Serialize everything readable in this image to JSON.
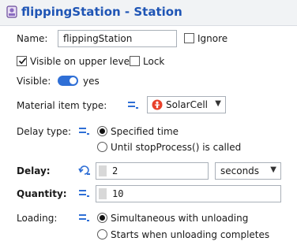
{
  "header": {
    "title": "flippingStation - Station",
    "logo_icon": "station-icon"
  },
  "name": {
    "label": "Name:",
    "value": "flippingStation",
    "ignore_label": "Ignore",
    "ignore_checked": false
  },
  "visible_upper": {
    "label": "Visible on upper level",
    "checked": true
  },
  "lock": {
    "label": "Lock",
    "checked": false
  },
  "visible": {
    "label": "Visible:",
    "value": "yes",
    "on": true
  },
  "material": {
    "label": "Material item type:",
    "value": "SolarCell",
    "item_icon": "agent-person-icon"
  },
  "delay_type": {
    "label": "Delay type:",
    "options": [
      "Specified time",
      "Until stopProcess() is called"
    ],
    "selected_index": 0
  },
  "delay": {
    "label": "Delay:",
    "value": "2",
    "unit": "seconds"
  },
  "quantity": {
    "label": "Quantity:",
    "value": "10"
  },
  "loading": {
    "label": "Loading:",
    "options": [
      "Simultaneous with unloading",
      "Starts when unloading completes"
    ],
    "selected_index": 0
  },
  "colors": {
    "accent": "#1f55b5",
    "toggle": "#2f6fd6",
    "agent": "#e8402a"
  }
}
